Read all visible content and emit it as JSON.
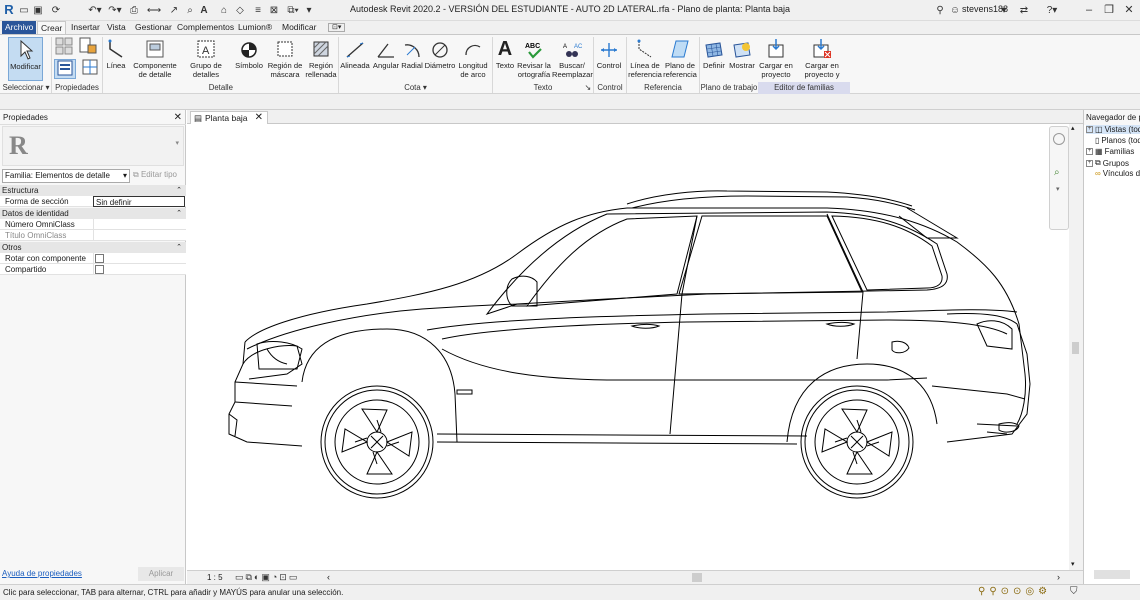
{
  "app_title": "Autodesk Revit 2020.2 - VERSIÓN DEL ESTUDIANTE - AUTO 2D LATERAL.rfa - Plano de planta: Planta baja",
  "user": "stevens188",
  "tabs": [
    "Archivo",
    "Crear",
    "Insertar",
    "Vista",
    "Gestionar",
    "Complementos",
    "Lumion®",
    "Modificar"
  ],
  "ribbon": {
    "buttons": [
      {
        "label": "Modificar"
      },
      {
        "label": "Línea"
      },
      {
        "label": "Componente de detalle"
      },
      {
        "label": "Grupo de detalles"
      },
      {
        "label": "Símbolo"
      },
      {
        "label": "Región de máscara"
      },
      {
        "label": "Región rellenada"
      },
      {
        "label": "Alineada"
      },
      {
        "label": "Angular"
      },
      {
        "label": "Radial"
      },
      {
        "label": "Diámetro"
      },
      {
        "label": "Longitud de arco"
      },
      {
        "label": "Texto"
      },
      {
        "label": "Revisar la ortografía"
      },
      {
        "label": "Buscar/ Reemplazar"
      },
      {
        "label": "Control"
      },
      {
        "label": "Línea de referencia"
      },
      {
        "label": "Plano de referencia"
      },
      {
        "label": "Definir"
      },
      {
        "label": "Mostrar"
      },
      {
        "label": "Cargar en proyecto"
      },
      {
        "label": "Cargar en proyecto y cerrar"
      }
    ],
    "panels": [
      "Seleccionar",
      "Propiedades",
      "Detalle",
      "Cota",
      "Texto",
      "Control",
      "Referencia",
      "Plano de trabajo",
      "Editor de familias"
    ]
  },
  "properties": {
    "title": "Propiedades",
    "family_selector": "Familia: Elementos de detalle",
    "edit_type": "Editar tipo",
    "sections": [
      {
        "name": "Estructura",
        "rows": [
          {
            "key": "Forma de sección",
            "value": "Sin definir"
          }
        ]
      },
      {
        "name": "Datos de identidad",
        "rows": [
          {
            "key": "Número OmniClass",
            "value": ""
          },
          {
            "key": "Título OmniClass",
            "value": ""
          }
        ]
      },
      {
        "name": "Otros",
        "rows": [
          {
            "key": "Rotar con componente",
            "value": ""
          },
          {
            "key": "Compartido",
            "value": ""
          }
        ]
      }
    ],
    "help_link": "Ayuda de propiedades",
    "apply": "Aplicar"
  },
  "view_tab": "Planta baja",
  "scale": "1 : 5",
  "browser": {
    "title": "Navegador de proyectos",
    "items": [
      "Vistas (todas)",
      "Planos (todos)",
      "Familias",
      "Grupos",
      "Vínculos de Revit"
    ]
  },
  "status_message": "Clic para seleccionar, TAB para alternar, CTRL para añadir y MAYÚS para anular una selección.",
  "colors": {
    "accent": "#2a5599",
    "selected": "#c4dcf2",
    "family_editor": "#d9dbee"
  }
}
